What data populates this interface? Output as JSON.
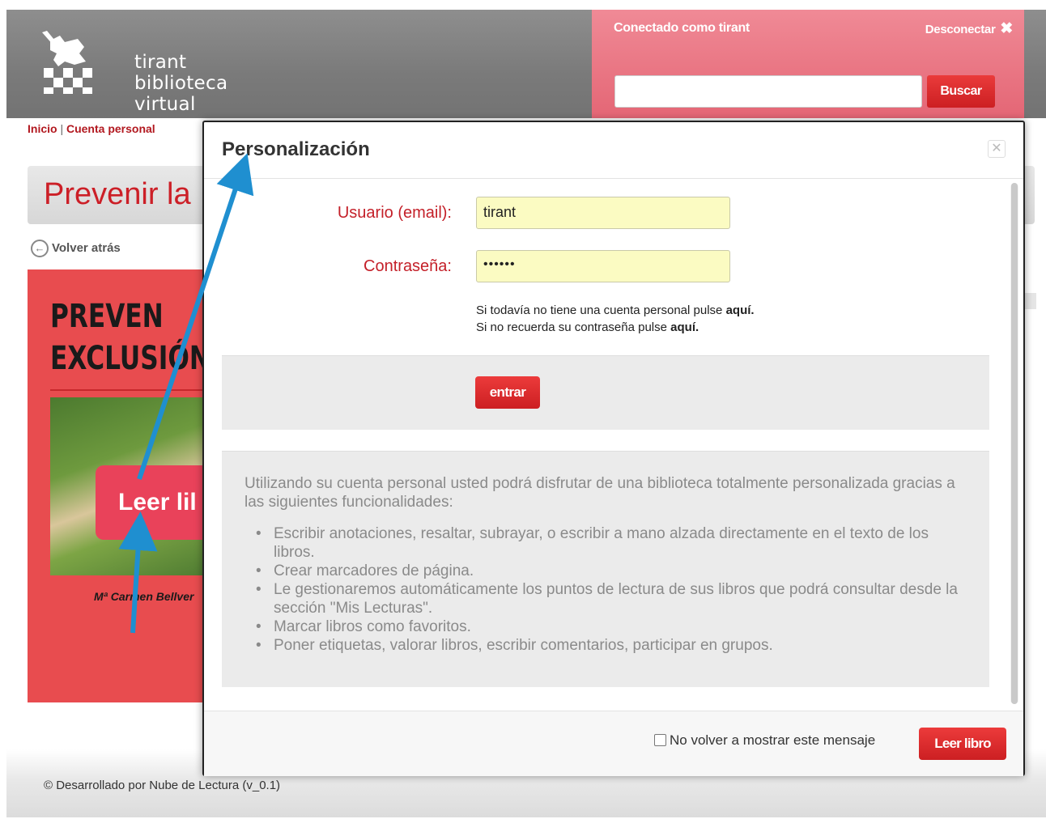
{
  "header": {
    "logo_line1": "tirant",
    "logo_line2": "biblioteca virtual",
    "connected_prefix": "Conectado como ",
    "connected_user": "tirant",
    "disconnect_label": "Desconectar",
    "disconnect_icon": "close-icon",
    "search_placeholder": "",
    "search_button": "Buscar"
  },
  "breadcrumb": {
    "home": "Inicio",
    "separator": "|",
    "current": "Cuenta personal"
  },
  "page": {
    "title": "Prevenir la",
    "back_label": "Volver atrás",
    "cover_title_line1": "PREVEN",
    "cover_title_line2": "EXCLUSIÓN",
    "cover_read_button": "Leer lil",
    "cover_author": "Mª Carmen Bellver"
  },
  "modal": {
    "title": "Personalización",
    "close_icon": "close-icon",
    "user_label": "Usuario (email):",
    "user_value": "tirant",
    "password_label": "Contraseña:",
    "password_value": "••••••",
    "hint1_text": "Si todavía no tiene una cuenta personal pulse ",
    "hint1_link": "aquí.",
    "hint2_text": "Si no recuerda su contraseña pulse ",
    "hint2_link": "aquí.",
    "enter_button": "entrar",
    "info_intro": "Utilizando su cuenta personal usted podrá disfrutar de una biblioteca totalmente personalizada gracias a las siguientes funcionalidades:",
    "features": [
      "Escribir anotaciones, resaltar, subrayar, o escribir a mano alzada directamente en el texto de los libros.",
      "Crear marcadores de página.",
      "Le gestionaremos automáticamente los puntos de lectura de sus libros que podrá consultar desde la sección \"Mis Lecturas\".",
      "Marcar libros como favoritos.",
      "Poner etiquetas, valorar libros, escribir comentarios, participar en grupos."
    ],
    "dont_show_label": "No volver a mostrar este mensaje",
    "read_book_button": "Leer libro"
  },
  "footer": {
    "text": "© Desarrollado por Nube de Lectura (v_0.1)"
  },
  "colors": {
    "brand_red": "#cc1f22",
    "login_panel_pink": "#e8707e",
    "input_yellow": "#fbfbc2",
    "arrow_blue": "#1f8fd0"
  }
}
